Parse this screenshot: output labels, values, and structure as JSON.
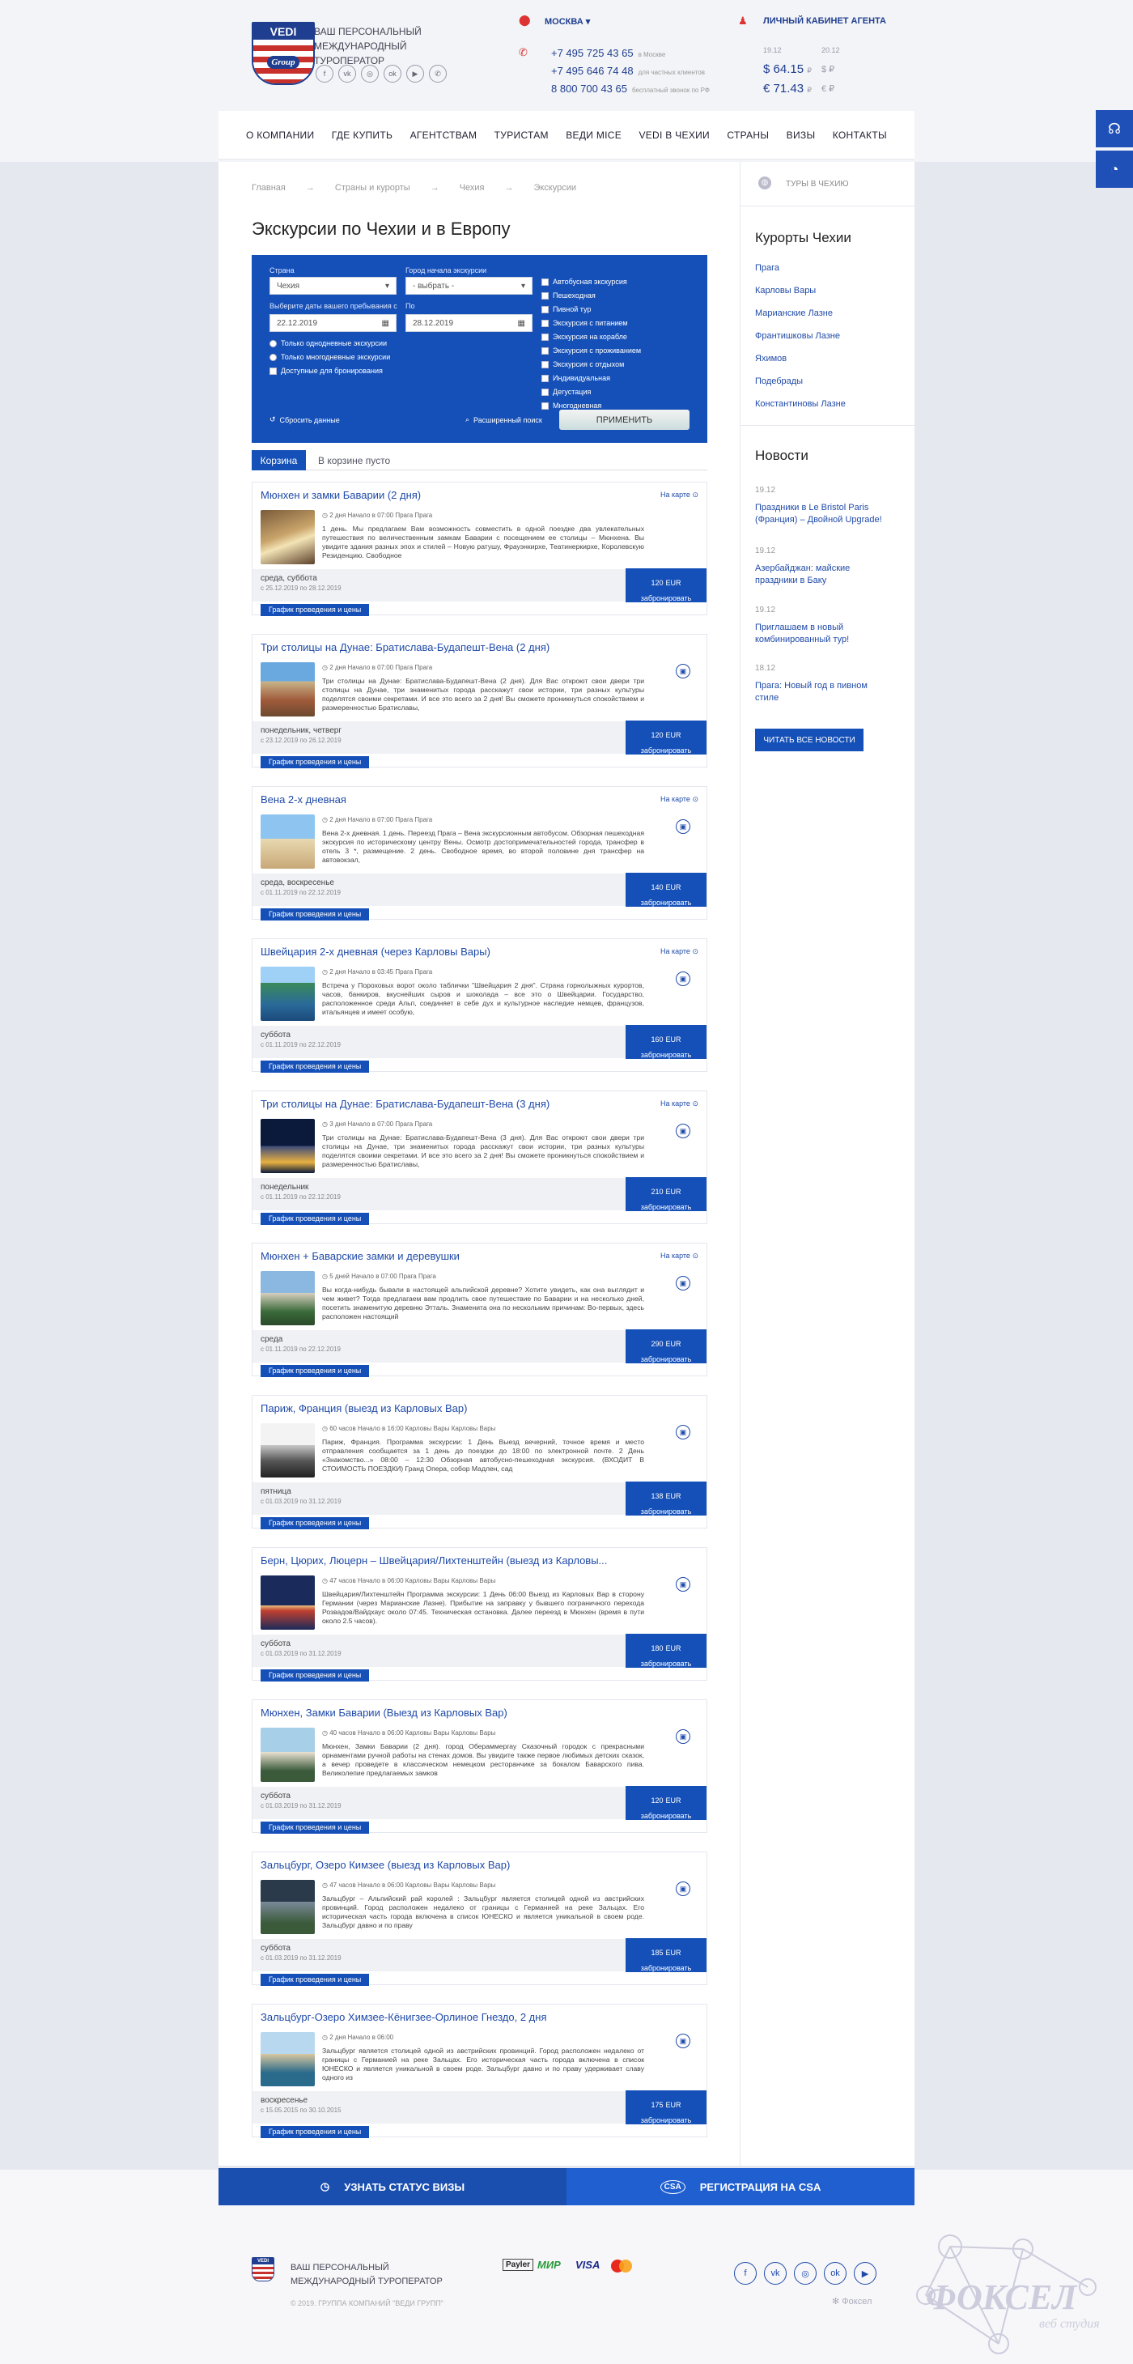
{
  "header": {
    "logo_top": "VEDI",
    "logo_script": "Group",
    "tagline1": "ВАШ ПЕРСОНАЛЬНЫЙ",
    "tagline2": "МЕЖДУНАРОДНЫЙ ТУРОПЕРАТОР",
    "city": "МОСКВА",
    "phones": [
      {
        "number": "+7 495 725 43 65",
        "note": "в Москве"
      },
      {
        "number": "+7 495 646 74 48",
        "note": "для частных клиентов"
      },
      {
        "number": "8 800 700 43 65",
        "note": "бесплатный звонок по РФ"
      }
    ],
    "agent_link": "ЛИЧНЫЙ КАБИНЕТ АГЕНТА",
    "rate_dates": [
      "19.12",
      "20.12"
    ],
    "rates": [
      {
        "value": "$ 64.15",
        "unit": "₽",
        "next": "$ ₽"
      },
      {
        "value": "€ 71.43",
        "unit": "₽",
        "next": "€ ₽"
      }
    ]
  },
  "nav": [
    "О КОМПАНИИ",
    "ГДЕ КУПИТЬ",
    "АГЕНТСТВАМ",
    "ТУРИСТАМ",
    "ВЕДИ MICE",
    "VEDI В ЧЕХИИ",
    "СТРАНЫ",
    "ВИЗЫ",
    "КОНТАКТЫ"
  ],
  "breadcrumbs": [
    "Главная",
    "Страны и курорты",
    "Чехия",
    "Экскурсии"
  ],
  "page_title": "Экскурсии по Чехии и в Европу",
  "filter": {
    "country_label": "Страна",
    "country_value": "Чехия",
    "city_label": "Город начала экскурсии",
    "city_value": "- выбрать -",
    "date_label": "Выберите даты вашего пребывания с",
    "date_from": "22.12.2019",
    "to_label": "По",
    "date_to": "28.12.2019",
    "options": [
      "Только однодневные экскурсии",
      "Только многодневные экскурсии",
      "Доступные для бронирования"
    ],
    "types": [
      "Автобусная экскурсия",
      "Пешеходная",
      "Пивной тур",
      "Экскурсия с питанием",
      "Экскурсия на корабле",
      "Экскурсия с проживанием",
      "Экскурсия с отдыхом",
      "Индивидуальная",
      "Дегустация",
      "Многодневная"
    ],
    "reset": "Сбросить данные",
    "advanced": "Расширенный поиск",
    "apply": "ПРИМЕНИТЬ"
  },
  "cart": {
    "tab": "Корзина",
    "status": "В корзине пусто"
  },
  "common": {
    "map": "На карте",
    "book": "забронировать",
    "currency": "EUR",
    "schedule": "График проведения и цены"
  },
  "tours": [
    {
      "title": "Мюнхен и замки Баварии (2 дня)",
      "meta": "2 дня Начало в 07:00   Прага   Прага",
      "desc": "1 день. Мы предлагаем Вам возможность совместить в одной поездке два увлекательных путешествия по величественным замкам Баварии с посещением ее столицы – Мюнхена. Вы увидите здания разных эпох и стилей – Новую ратушу, Фрауэнкирхе, Театинеркирхе, Королевскую Резиденцию. Свободное",
      "days": "среда, суббота",
      "dates": "с 25.12.2019 по 28.12.2019",
      "price": "120",
      "map": true,
      "bus": false
    },
    {
      "title": "Три столицы на Дунае: Братислава-Будапешт-Вена (2 дня)",
      "meta": "2 дня Начало в 07:00   Прага   Прага",
      "desc": "Три столицы на Дунае: Братислава-Будапешт-Вена (2 дня). Для Вас откроют свои двери три столицы на Дунае, три знаменитых города расскажут свои истории, три разных культуры поделятся своими секретами. И все это всего за 2 дня! Вы сможете проникнуться спокойствием и размеренностью Братиславы,",
      "days": "понедельник, четверг",
      "dates": "с 23.12.2019 по 26.12.2019",
      "price": "120",
      "map": false,
      "bus": true
    },
    {
      "title": "Вена 2-х дневная",
      "meta": "2 дня Начало в 07:00   Прага   Прага",
      "desc": "Вена 2-х дневная. 1 день. Переезд Прага – Вена экскурсионным автобусом. Обзорная пешеходная экскурсия по историческому центру Вены. Осмотр достопримечательностей города, трансфер в отель 3 *, размещение. 2 день. Свободное время, во второй половине дня трансфер на автовокзал,",
      "days": "среда, воскресенье",
      "dates": "с 01.11.2019 по 22.12.2019",
      "price": "140",
      "map": true,
      "bus": true
    },
    {
      "title": "Швейцария 2-х дневная (через Карловы Вары)",
      "meta": "2 дня Начало в 03:45   Прага   Прага",
      "desc": "Встреча у Пороховых ворот около таблички \"Швейцария 2 дня\". Страна горнолыжных курортов, часов, банкиров, вкуснейших сыров и шоколада – все это о Швейцарии. Государство, расположенное среди Альп, соединяет в себе дух и культурное наследие немцев, французов, итальянцев и имеет особую,",
      "days": "суббота",
      "dates": "с 01.11.2019 по 22.12.2019",
      "price": "160",
      "map": true,
      "bus": true
    },
    {
      "title": "Три столицы на Дунае: Братислава-Будапешт-Вена (3 дня)",
      "meta": "3 дня Начало в 07:00   Прага   Прага",
      "desc": "Три столицы на Дунае: Братислава-Будапешт-Вена (3 дня). Для Вас откроют свои двери три столицы на Дунае, три знаменитых города расскажут свои истории, три разных культуры поделятся своими секретами. И все это всего за 2 дня! Вы сможете проникнуться спокойствием и размеренностью Братиславы,",
      "days": "понедельник",
      "dates": "с 01.11.2019 по 22.12.2019",
      "price": "210",
      "map": true,
      "bus": true
    },
    {
      "title": "Мюнхен + Баварские замки и деревушки",
      "meta": "5 дней Начало в 07:00   Прага   Прага",
      "desc": "Вы когда-нибудь бывали в настоящей альпийской деревне? Хотите увидеть, как она выглядит и чем живет? Тогда предлагаем вам продлить свое путешествие по Баварии и на несколько дней, посетить знаменитую деревню Этталь. Знаменита она по нескольким причинам: Во-первых, здесь расположен настоящий",
      "days": "среда",
      "dates": "с 01.11.2019 по 22.12.2019",
      "price": "290",
      "map": true,
      "bus": true
    },
    {
      "title": "Париж, Франция (выезд из Карловых Вар)",
      "meta": "60 часов Начало в 16:00   Карловы Вары   Карловы Вары",
      "desc": "Париж, Франция. Программа экскурсии: 1 День Выезд вечерний, точное время и место отправления сообщается за 1 день до поездки до 18:00 по электронной почте. 2 День «Знакомство...» 08:00 – 12:30 Обзорная автобусно-пешеходная экскурсия. (ВХОДИТ В СТОИМОСТЬ ПОЕЗДКИ) Гранд Опера, собор Мадлен, сад",
      "days": "пятница",
      "dates": "с 01.03.2019 по 31.12.2019",
      "price": "138",
      "map": false,
      "bus": true
    },
    {
      "title": "Берн, Цюрих, Люцерн – Швейцария/Лихтенштейн (выезд из Карловы...",
      "meta": "47 часов Начало в 06:00   Карловы Вары   Карловы Вары",
      "desc": "Швейцария/Лихтенштейн Программа экскурсии: 1 День 06:00 Выезд из Карловых Вар в сторону Германии (через Марианские Лазне). Прибытие на заправку у бывшего пограничного перехода Розвадов/Вайдхаус около 07:45. Техническая остановка. Далее переезд в Мюнхен (время в пути около 2.5 часов).",
      "days": "суббота",
      "dates": "с 01.03.2019 по 31.12.2019",
      "price": "180",
      "map": false,
      "bus": true
    },
    {
      "title": "Мюнхен, Замки Баварии (Выезд из Карловых Вар)",
      "meta": "40 часов Начало в 06:00   Карловы Вары   Карловы Вары",
      "desc": "Мюнхен, Замки Баварии (2 дня). город Обераммергау Сказочный городок с прекрасными орнаментами ручной работы на стенах домов. Вы увидите также первое любимых детских сказок, а вечер проведете в классическом немецком ресторанчике за бокалом Баварского пива. Великолепие предлагаемых замков",
      "days": "суббота",
      "dates": "с 01.03.2019 по 31.12.2019",
      "price": "120",
      "map": false,
      "bus": true
    },
    {
      "title": "Зальцбург, Озеро Кимзее (выезд из Карловых Вар)",
      "meta": "47 часов Начало в 06:00   Карловы Вары   Карловы Вары",
      "desc": "Зальцбург – Альпийский рай королей : Зальцбург является столицей одной из австрийских провинций. Город расположен недалеко от границы с Германией на реке Зальцах. Его историческая часть города включена в список ЮНЕСКО и является уникальной в своем роде. Зальцбург давно и по праву",
      "days": "суббота",
      "dates": "с 01.03.2019 по 31.12.2019",
      "price": "185",
      "map": false,
      "bus": true
    },
    {
      "title": "Зальцбург-Озеро Химзее-Кёнигзее-Орлиное Гнездо, 2 дня",
      "meta": "2 дня Начало в 06:00",
      "desc": "Зальцбург является столицей одной из австрийских провинций. Город расположен недалеко от границы с Германией на реке Зальцах. Его историческая часть города включена в список ЮНЕСКО и является уникальной в своем роде. Зальцбург давно и по праву удерживает славу одного из",
      "days": "воскресенье",
      "dates": "с 15.05.2015 по 30.10.2015",
      "price": "175",
      "map": false,
      "bus": true
    }
  ],
  "sidebar": {
    "tours_link": "ТУРЫ В ЧЕХИЮ",
    "resorts_title": "Курорты Чехии",
    "resorts": [
      "Прага",
      "Карловы Вары",
      "Марианские Лазне",
      "Франтишковы Лазне",
      "Яхимов",
      "Подебрады",
      "Константиновы Лазне"
    ],
    "news_title": "Новости",
    "news": [
      {
        "date": "19.12",
        "text": "Праздники в Le Bristol Paris (Франция) – Двойной Upgrade!"
      },
      {
        "date": "19.12",
        "text": "Азербайджан: майские праздники в Баку"
      },
      {
        "date": "19.12",
        "text": "Приглашаем в новый комбинированный тур!"
      },
      {
        "date": "18.12",
        "text": "Прага: Новый год в пивном стиле"
      }
    ],
    "all_news": "ЧИТАТЬ ВСЕ НОВОСТИ"
  },
  "bottom_bar": {
    "visa": "УЗНАТЬ СТАТУС ВИЗЫ",
    "csa": "РЕГИСТРАЦИЯ НА CSA",
    "csa_icon": "CSA"
  },
  "footer": {
    "tagline1": "ВАШ ПЕРСОНАЛЬНЫЙ",
    "tagline2": "МЕЖДУНАРОДНЫЙ ТУРОПЕРАТОР",
    "copyright": "© 2019. ГРУППА КОМПАНИЙ \"ВЕДИ ГРУПП\"",
    "payments": [
      "Payler",
      "МИР",
      "VISA"
    ],
    "foxel_small": "Фоксел",
    "foxel_big": "ФОКСЕЛ",
    "foxel_sub": "веб студия"
  },
  "colors": {
    "brand": "#1550b8",
    "link": "#1f4aa8",
    "accent_red": "#c8312b"
  }
}
